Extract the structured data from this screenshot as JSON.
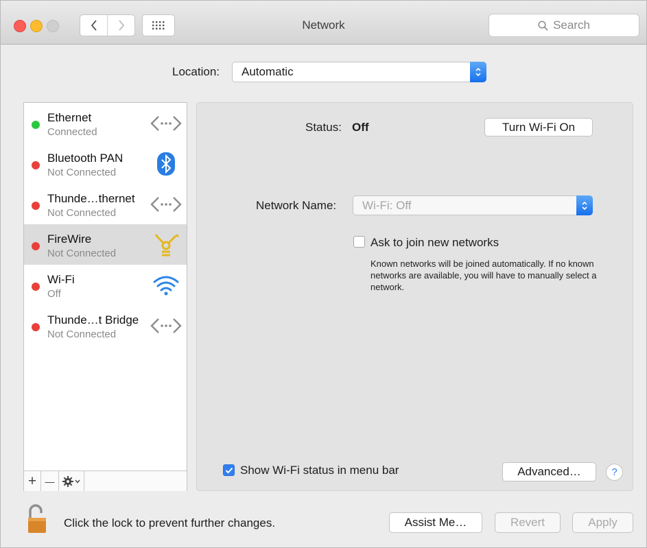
{
  "window": {
    "title": "Network"
  },
  "toolbar": {
    "search_placeholder": "Search"
  },
  "location": {
    "label": "Location:",
    "value": "Automatic"
  },
  "services": [
    {
      "name": "Ethernet",
      "status": "Connected",
      "dot": "#2ac840",
      "icon": "ethernet-icon"
    },
    {
      "name": "Bluetooth PAN",
      "status": "Not Connected",
      "dot": "#e8413b",
      "icon": "bluetooth-icon"
    },
    {
      "name": "Thunde…thernet",
      "status": "Not Connected",
      "dot": "#e8413b",
      "icon": "ethernet-icon"
    },
    {
      "name": "FireWire",
      "status": "Not Connected",
      "dot": "#e8413b",
      "icon": "firewire-icon",
      "selected": true
    },
    {
      "name": "Wi-Fi",
      "status": "Off",
      "dot": "#e8413b",
      "icon": "wifi-icon"
    },
    {
      "name": "Thunde…t Bridge",
      "status": "Not Connected",
      "dot": "#e8413b",
      "icon": "ethernet-icon"
    }
  ],
  "sidebar_tools": {
    "add": "+",
    "remove": "—"
  },
  "detail": {
    "status_label": "Status:",
    "status_value": "Off",
    "turn_on_button": "Turn Wi-Fi On",
    "network_name_label": "Network Name:",
    "network_name_value": "Wi-Fi: Off",
    "ask_join_label": "Ask to join new networks",
    "ask_join_desc": "Known networks will be joined automatically. If no known networks are available, you will have to manually select a network.",
    "show_status_label": "Show Wi-Fi status in menu bar",
    "show_status_checked": true,
    "advanced_button": "Advanced…",
    "help": "?"
  },
  "footer": {
    "lock_text": "Click the lock to prevent further changes.",
    "assist_button": "Assist Me…",
    "revert_button": "Revert",
    "apply_button": "Apply"
  }
}
